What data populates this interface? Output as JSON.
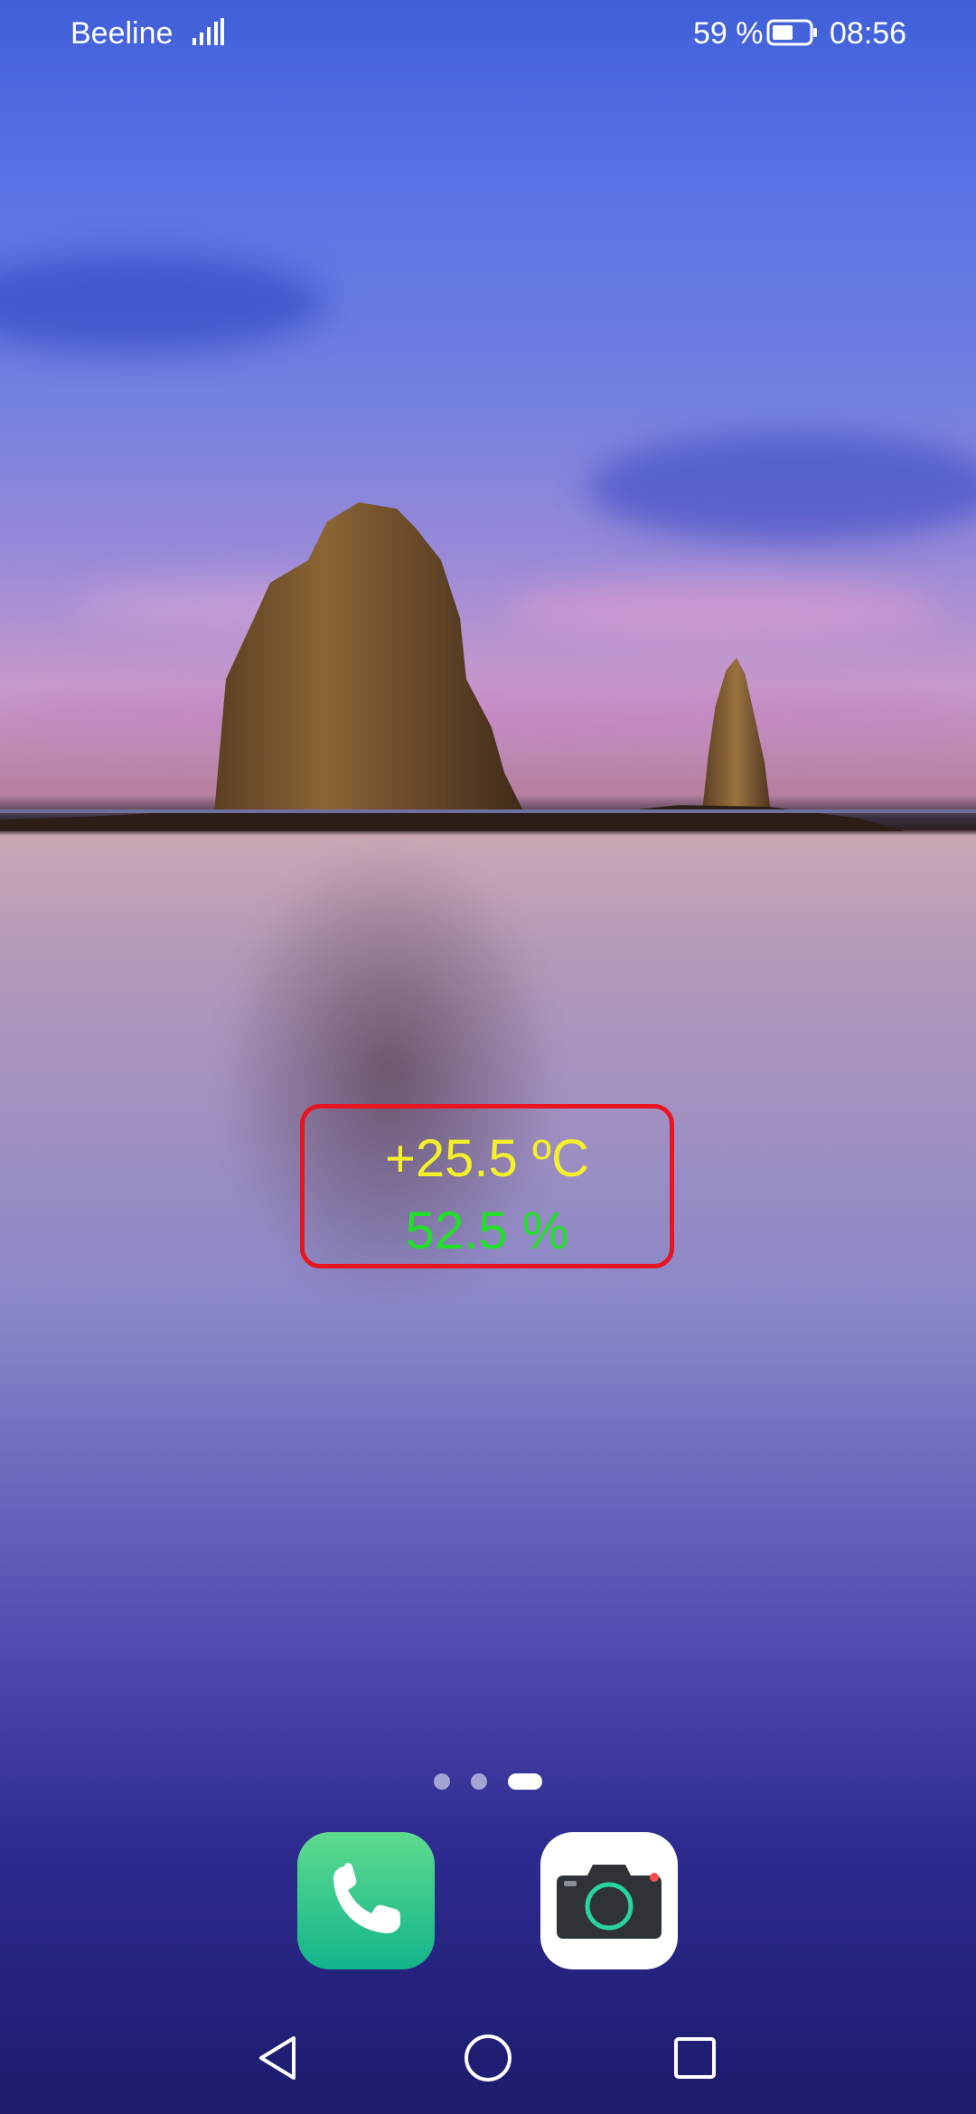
{
  "status_bar": {
    "carrier": "Beeline",
    "battery_percent": "59 %",
    "battery_level": 0.59,
    "time": "08:56"
  },
  "widget": {
    "temperature": "+25.5 ºC",
    "humidity": "52.5 %",
    "colors": {
      "border": "#e8141f",
      "temperature": "#f5f02a",
      "humidity": "#22e02a"
    }
  },
  "page_indicator": {
    "pages": 3,
    "active_page": 3
  },
  "dock": {
    "apps": [
      {
        "icon": "phone-icon"
      },
      {
        "icon": "camera-icon"
      }
    ]
  },
  "navigation": {
    "buttons": [
      "back-icon",
      "home-icon",
      "recents-icon"
    ]
  }
}
